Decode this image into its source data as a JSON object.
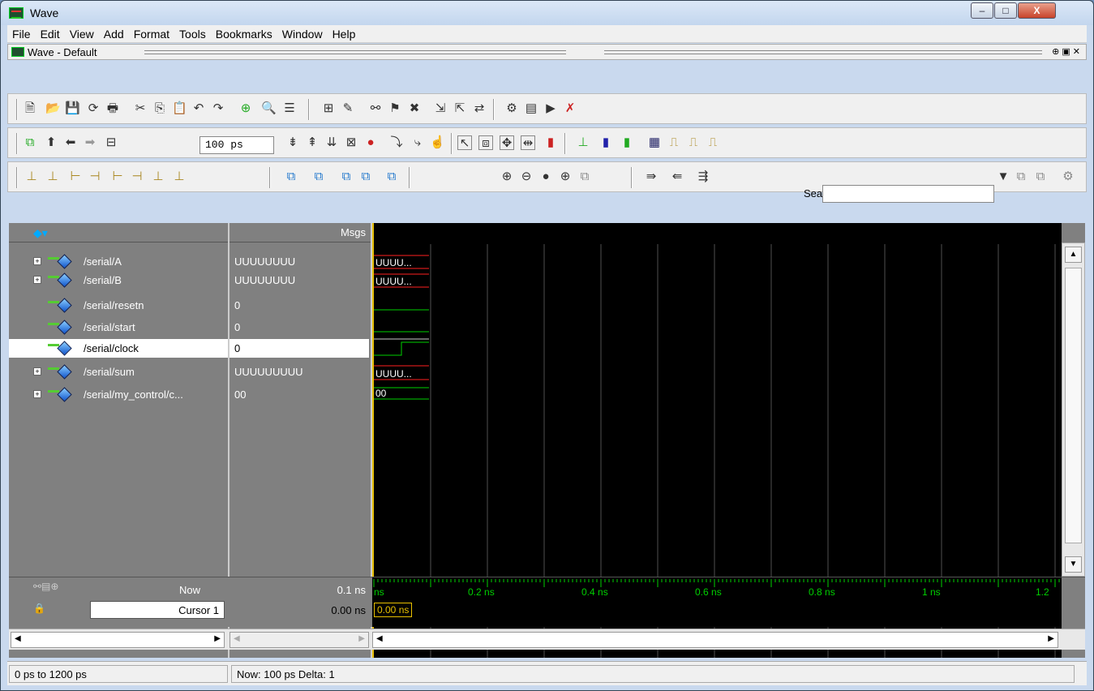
{
  "window": {
    "title": "Wave",
    "min": "–",
    "max": "□",
    "close": "X"
  },
  "menu": [
    "File",
    "Edit",
    "View",
    "Add",
    "Format",
    "Tools",
    "Bookmarks",
    "Window",
    "Help"
  ],
  "subwindow": {
    "title": "Wave - Default"
  },
  "toolbar2": {
    "zoom_value": "100 ps"
  },
  "toolbar3": {
    "search_label": "Search:"
  },
  "header": {
    "msgs": "Msgs"
  },
  "signals": [
    {
      "name": "/serial/A",
      "value": "UUUUUUUU",
      "wave": "UUUU...",
      "expandable": true
    },
    {
      "name": "/serial/B",
      "value": "UUUUUUUU",
      "wave": "UUUU...",
      "expandable": true
    },
    {
      "name": "/serial/resetn",
      "value": "0",
      "wave": "",
      "expandable": false
    },
    {
      "name": "/serial/start",
      "value": "0",
      "wave": "",
      "expandable": false
    },
    {
      "name": "/serial/clock",
      "value": "0",
      "wave": "",
      "expandable": false,
      "selected": true
    },
    {
      "name": "/serial/sum",
      "value": "UUUUUUUUU",
      "wave": "UUUU...",
      "expandable": true
    },
    {
      "name": "/serial/my_control/c...",
      "value": "00",
      "wave": "00",
      "expandable": true
    }
  ],
  "timeline": {
    "now_label": "Now",
    "now_value": "0.1 ns",
    "cursor_name": "Cursor 1",
    "cursor_value": "0.00 ns",
    "cursor_badge": "0.00 ns",
    "ticks": [
      {
        "label": "ns"
      },
      {
        "label": "0.2 ns"
      },
      {
        "label": "0.4 ns"
      },
      {
        "label": "0.6 ns"
      },
      {
        "label": "0.8 ns"
      },
      {
        "label": "1 ns"
      },
      {
        "label": "1.2"
      }
    ]
  },
  "status": {
    "range": "0 ps to 1200 ps",
    "now": "Now: 100 ps  Delta: 1"
  },
  "colors": {
    "wave_bg": "#000000",
    "green": "#00d000",
    "red": "#ff2020",
    "cursor": "#e8c000",
    "grid": "#505050"
  }
}
